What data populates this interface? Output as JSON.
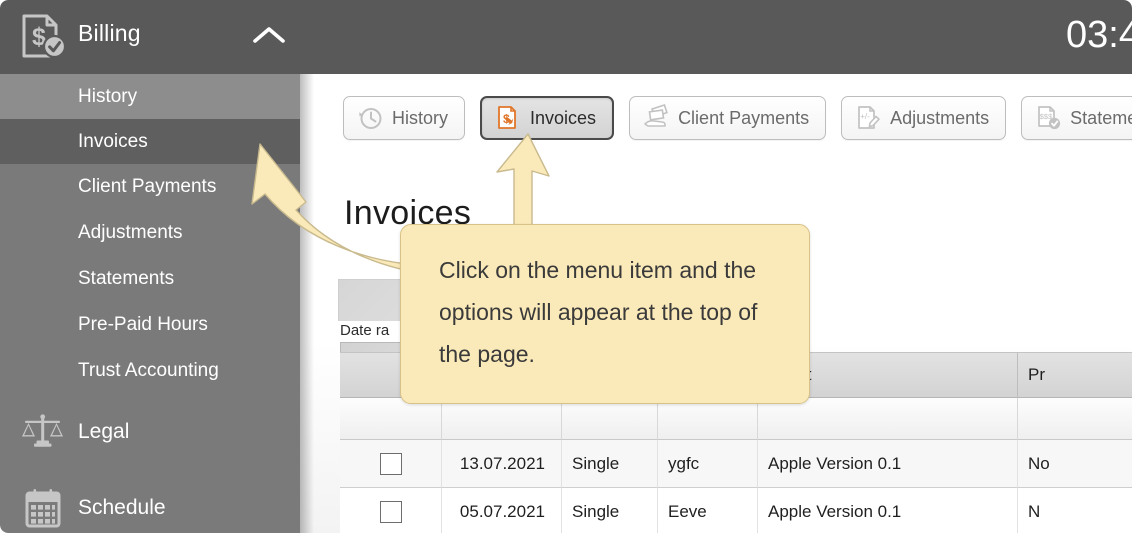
{
  "topbar": {
    "brand_title": "Billing",
    "brand_icon": "invoice-dollar-check-icon",
    "collapse_icon": "chevron-up-icon",
    "clock": "03:4"
  },
  "sidebar": {
    "background": "#7a7a7a",
    "items": [
      {
        "label": "History",
        "state": "hovered"
      },
      {
        "label": "Invoices",
        "state": "selected"
      },
      {
        "label": "Client Payments",
        "state": "normal"
      },
      {
        "label": "Adjustments",
        "state": "normal"
      },
      {
        "label": "Statements",
        "state": "normal"
      },
      {
        "label": "Pre-Paid Hours",
        "state": "normal"
      },
      {
        "label": "Trust Accounting",
        "state": "normal"
      }
    ],
    "groups": [
      {
        "label": "Legal",
        "icon": "scales-of-justice-icon"
      },
      {
        "label": "Schedule",
        "icon": "calendar-icon"
      }
    ]
  },
  "toolbar": {
    "buttons": [
      {
        "label": "History",
        "icon": "clock-history-icon",
        "active": false
      },
      {
        "label": "Invoices",
        "icon": "invoice-icon",
        "active": true
      },
      {
        "label": "Client Payments",
        "icon": "hand-money-icon",
        "active": false
      },
      {
        "label": "Adjustments",
        "icon": "adjustment-pencil-icon",
        "active": false
      },
      {
        "label": "Statements",
        "icon": "statement-check-icon",
        "active": false
      }
    ]
  },
  "main": {
    "page_title": "Invoices",
    "date_range_label": "Date ra",
    "table": {
      "headers": [
        "",
        "",
        "",
        "",
        "Client",
        "Pr"
      ],
      "rows": [
        {
          "date": "13.07.2021",
          "type": "Single",
          "matter": "ygfc",
          "client": "Apple Version 0.1",
          "pro": "No"
        },
        {
          "date": "05.07.2021",
          "type": "Single",
          "matter": "Eeve",
          "client": "Apple Version 0.1",
          "pro": "N"
        }
      ]
    }
  },
  "callout": {
    "text": "Click on the menu item and the options will appear at the top of the page.",
    "background": "#fbeab9",
    "border": "#d8c287",
    "arrow_left_target": "sidebar-item-invoices",
    "arrow_up_target": "toolbar-button-invoices"
  }
}
